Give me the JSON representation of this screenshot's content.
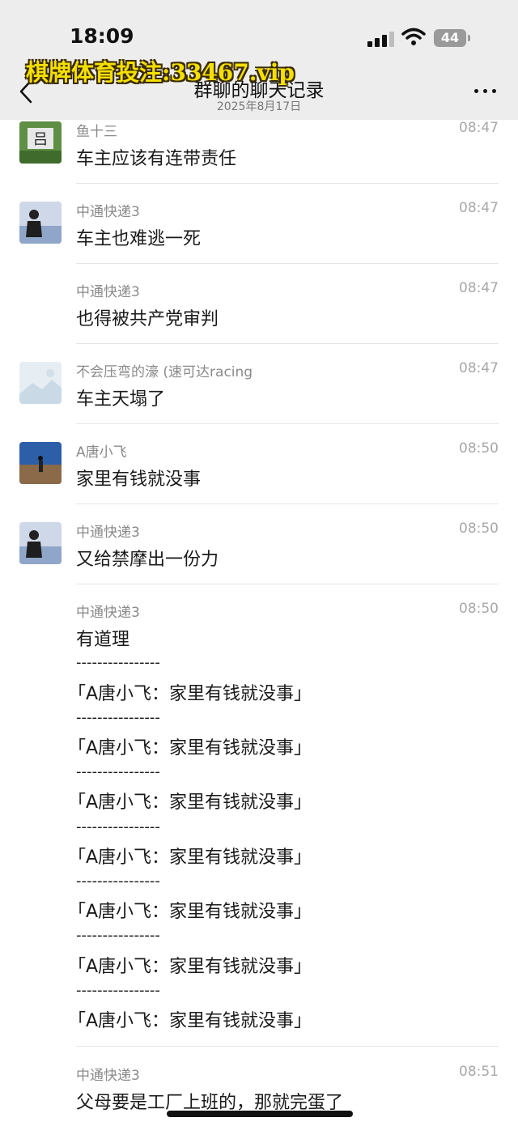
{
  "status_bar": {
    "time": "18:09",
    "battery": "44"
  },
  "header": {
    "title": "群聊的聊天记录",
    "date": "2025年8月17日"
  },
  "watermark": "棋牌体育投注:33467.vip",
  "messages": [
    {
      "sender": "鱼十三",
      "time": "08:47",
      "text": "车主应该有连带责任"
    },
    {
      "sender": "中通快递3",
      "time": "08:47",
      "text": "车主也难逃一死"
    },
    {
      "sender": "中通快递3",
      "time": "08:47",
      "text": "也得被共产党审判"
    },
    {
      "sender": "不会压弯的濠 (速可达racing",
      "time": "08:47",
      "text": "车主天塌了"
    },
    {
      "sender": "A唐小飞",
      "time": "08:50",
      "text": "家里有钱就没事"
    },
    {
      "sender": "中通快递3",
      "time": "08:50",
      "text": "又给禁摩出一份力"
    },
    {
      "sender": "中通快递3",
      "time": "08:50",
      "text": "有道理"
    },
    {
      "sender": "中通快递3",
      "time": "08:51",
      "text": "父母要是工厂上班的，那就完蛋了"
    }
  ],
  "quote": {
    "separator": "----------------",
    "line": "「A唐小飞：家里有钱就没事」"
  }
}
